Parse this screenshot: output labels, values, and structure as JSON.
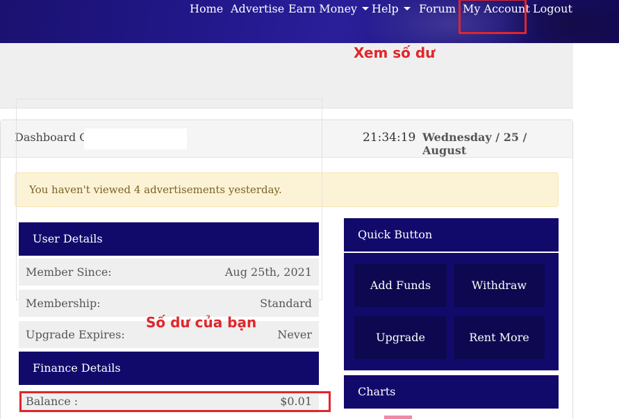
{
  "nav": {
    "items": [
      {
        "label": "Home"
      },
      {
        "label": "Advertise"
      },
      {
        "label": "Earn Money"
      },
      {
        "label": "Help"
      },
      {
        "label": "Forum"
      },
      {
        "label": "My Account"
      },
      {
        "label": "Logout"
      }
    ]
  },
  "annotations": {
    "view_balance": "Xem số dư",
    "your_balance": "Số dư của bạn"
  },
  "dashboard": {
    "title": "Dashboard Of",
    "time": "21:34:19",
    "date": "Wednesday / 25 / August"
  },
  "alert": {
    "message": "You haven't viewed 4 advertisements yesterday."
  },
  "user_details": {
    "heading": "User Details",
    "rows": [
      {
        "label": "Member Since:",
        "value": "Aug 25th, 2021"
      },
      {
        "label": "Membership:",
        "value": "Standard"
      },
      {
        "label": "Upgrade Expires:",
        "value": "Never"
      }
    ]
  },
  "finance_details": {
    "heading": "Finance Details",
    "balance_label": "Balance :",
    "balance_value": "$0.01"
  },
  "quick_button": {
    "heading": "Quick Button",
    "buttons": [
      {
        "label": "Add Funds"
      },
      {
        "label": "Withdraw"
      },
      {
        "label": "Upgrade"
      },
      {
        "label": "Rent More"
      }
    ]
  },
  "charts": {
    "heading": "Charts"
  },
  "colors": {
    "accent_dark": "#120a6b",
    "highlight_red": "#e0262b",
    "alert_bg": "#fcf3d6"
  }
}
